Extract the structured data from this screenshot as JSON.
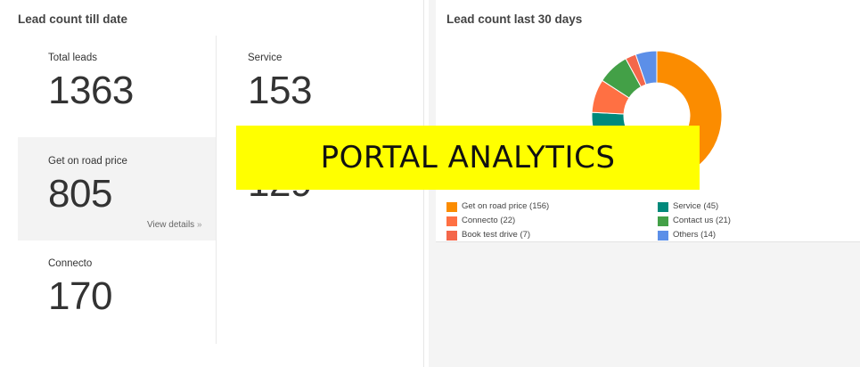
{
  "left_panel": {
    "title": "Lead count till date",
    "stats": {
      "total": {
        "label": "Total leads",
        "value": "1363"
      },
      "service": {
        "label": "Service",
        "value": "153"
      },
      "onroad": {
        "label": "Get on road price",
        "value": "805"
      },
      "fourth": {
        "label": "",
        "value": "129"
      },
      "connecto": {
        "label": "Connecto",
        "value": "170"
      }
    },
    "view_details": "View details",
    "view_details_chevron": "»"
  },
  "right_panel": {
    "title": "Lead count last 30 days"
  },
  "banner": {
    "text": "PORTAL ANALYTICS",
    "color": "#ffff00"
  },
  "chart_data": {
    "type": "pie",
    "donut": true,
    "title": "Lead count last 30 days",
    "series": [
      {
        "name": "Get on road price",
        "value": 156,
        "color": "#fb8c00",
        "legend": "Get on road price (156)"
      },
      {
        "name": "Service",
        "value": 45,
        "color": "#00897b",
        "legend": "Service (45)"
      },
      {
        "name": "Connecto",
        "value": 22,
        "color": "#ff7043",
        "legend": "Connecto (22)"
      },
      {
        "name": "Contact us",
        "value": 21,
        "color": "#43a047",
        "legend": "Contact us (21)"
      },
      {
        "name": "Book test drive",
        "value": 7,
        "color": "#f4674b",
        "legend": "Book test drive (7)"
      },
      {
        "name": "Others",
        "value": 14,
        "color": "#5c8fe8",
        "legend": "Others (14)"
      }
    ],
    "slice_order": [
      "Get on road price",
      "Service",
      "Connecto",
      "Contact us",
      "Book test drive",
      "Others"
    ],
    "legend_placement": "bottom"
  }
}
